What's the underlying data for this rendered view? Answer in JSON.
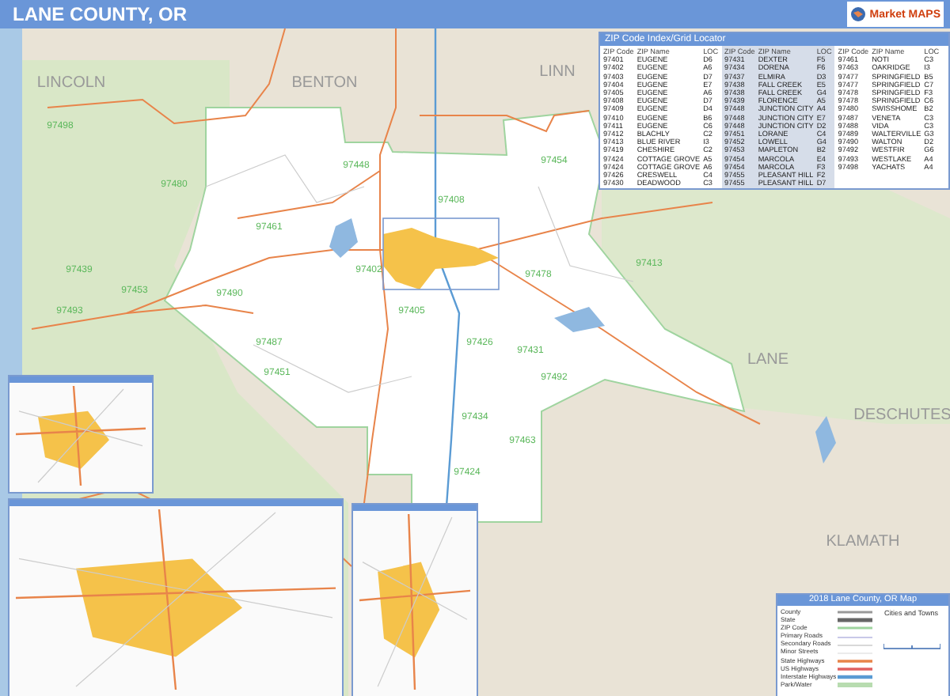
{
  "header": {
    "title": "LANE COUNTY, OR",
    "logo": "Market MAPS"
  },
  "map": {
    "county_labels": [
      "LINCOLN",
      "BENTON",
      "LINN",
      "LANE",
      "DESCHUTES",
      "KLAMATH"
    ],
    "zip_labels": [
      "97498",
      "97480",
      "97439",
      "97453",
      "97493",
      "97490",
      "97487",
      "97451",
      "97461",
      "97402",
      "97405",
      "97448",
      "97408",
      "97454",
      "97478",
      "97426",
      "97431",
      "97434",
      "97424",
      "97492",
      "97463",
      "97413"
    ]
  },
  "zip_index": {
    "title": "ZIP Code Index/Grid Locator",
    "groups": [
      {
        "columns": [
          "ZIP Code",
          "ZIP Name",
          "LOC"
        ],
        "rows": [
          {
            "zip": "97401",
            "name": "EUGENE",
            "loc": "D6"
          },
          {
            "zip": "97402",
            "name": "EUGENE",
            "loc": "A6"
          },
          {
            "zip": "97403",
            "name": "EUGENE",
            "loc": "D7"
          },
          {
            "zip": "97404",
            "name": "EUGENE",
            "loc": "E7"
          },
          {
            "zip": "97405",
            "name": "EUGENE",
            "loc": "A6"
          },
          {
            "zip": "97408",
            "name": "EUGENE",
            "loc": "D7"
          },
          {
            "zip": "97409",
            "name": "EUGENE",
            "loc": "D4"
          },
          {
            "zip": "97410",
            "name": "EUGENE",
            "loc": "B6"
          },
          {
            "zip": "97411",
            "name": "EUGENE",
            "loc": "C6"
          },
          {
            "zip": "97412",
            "name": "BLACHLY",
            "loc": "C2"
          },
          {
            "zip": "97413",
            "name": "BLUE RIVER",
            "loc": "I3"
          },
          {
            "zip": "97419",
            "name": "CHESHIRE",
            "loc": "C2"
          },
          {
            "zip": "97424",
            "name": "COTTAGE GROVE",
            "loc": "A5"
          },
          {
            "zip": "97424",
            "name": "COTTAGE GROVE",
            "loc": "A6"
          },
          {
            "zip": "97426",
            "name": "CRESWELL",
            "loc": "C4"
          },
          {
            "zip": "97430",
            "name": "DEADWOOD",
            "loc": "C3"
          }
        ]
      },
      {
        "columns": [
          "ZIP Code",
          "ZIP Name",
          "LOC"
        ],
        "rows": [
          {
            "zip": "97431",
            "name": "DEXTER",
            "loc": "F5"
          },
          {
            "zip": "97434",
            "name": "DORENA",
            "loc": "F6"
          },
          {
            "zip": "97437",
            "name": "ELMIRA",
            "loc": "D3"
          },
          {
            "zip": "97438",
            "name": "FALL CREEK",
            "loc": "E5"
          },
          {
            "zip": "97438",
            "name": "FALL CREEK",
            "loc": "G4"
          },
          {
            "zip": "97439",
            "name": "FLORENCE",
            "loc": "A5"
          },
          {
            "zip": "97448",
            "name": "JUNCTION CITY",
            "loc": "A4"
          },
          {
            "zip": "97448",
            "name": "JUNCTION CITY",
            "loc": "E7"
          },
          {
            "zip": "97448",
            "name": "JUNCTION CITY",
            "loc": "D2"
          },
          {
            "zip": "97451",
            "name": "LORANE",
            "loc": "C4"
          },
          {
            "zip": "97452",
            "name": "LOWELL",
            "loc": "G4"
          },
          {
            "zip": "97453",
            "name": "MAPLETON",
            "loc": "B2"
          },
          {
            "zip": "97454",
            "name": "MARCOLA",
            "loc": "E4"
          },
          {
            "zip": "97454",
            "name": "MARCOLA",
            "loc": "F3"
          },
          {
            "zip": "97455",
            "name": "PLEASANT HILL",
            "loc": "F2"
          },
          {
            "zip": "97455",
            "name": "PLEASANT HILL",
            "loc": "D7"
          }
        ]
      },
      {
        "columns": [
          "ZIP Code",
          "ZIP Name",
          "LOC"
        ],
        "rows": [
          {
            "zip": "97461",
            "name": "NOTI",
            "loc": "C3"
          },
          {
            "zip": "97463",
            "name": "OAKRIDGE",
            "loc": "I3"
          },
          {
            "zip": "97477",
            "name": "SPRINGFIELD",
            "loc": "B5"
          },
          {
            "zip": "97477",
            "name": "SPRINGFIELD",
            "loc": "C7"
          },
          {
            "zip": "97478",
            "name": "SPRINGFIELD",
            "loc": "F3"
          },
          {
            "zip": "97478",
            "name": "SPRINGFIELD",
            "loc": "C6"
          },
          {
            "zip": "97480",
            "name": "SWISSHOME",
            "loc": "B2"
          },
          {
            "zip": "97487",
            "name": "VENETA",
            "loc": "C3"
          },
          {
            "zip": "97488",
            "name": "VIDA",
            "loc": "C3"
          },
          {
            "zip": "97489",
            "name": "WALTERVILLE",
            "loc": "G3"
          },
          {
            "zip": "97490",
            "name": "WALTON",
            "loc": "D2"
          },
          {
            "zip": "97492",
            "name": "WESTFIR",
            "loc": "G6"
          },
          {
            "zip": "97493",
            "name": "WESTLAKE",
            "loc": "A4"
          },
          {
            "zip": "97498",
            "name": "YACHATS",
            "loc": "A4"
          }
        ]
      }
    ]
  },
  "legend": {
    "title": "2018 Lane County, OR Map",
    "items": [
      {
        "kind": "county",
        "label": "County"
      },
      {
        "kind": "state",
        "label": "State"
      },
      {
        "kind": "zip",
        "label": "ZIP Code"
      },
      {
        "kind": "primary",
        "label": "Primary Roads"
      },
      {
        "kind": "secondary",
        "label": "Secondary Roads"
      },
      {
        "kind": "minor",
        "label": "Minor Streets"
      },
      {
        "kind": "state_hwy",
        "label": "State Highways"
      },
      {
        "kind": "us_hwy",
        "label": "US Highways"
      },
      {
        "kind": "interstate",
        "label": "Interstate Highways"
      },
      {
        "kind": "park",
        "label": "Park/Water"
      }
    ],
    "cities_title": "Cities and Towns"
  }
}
